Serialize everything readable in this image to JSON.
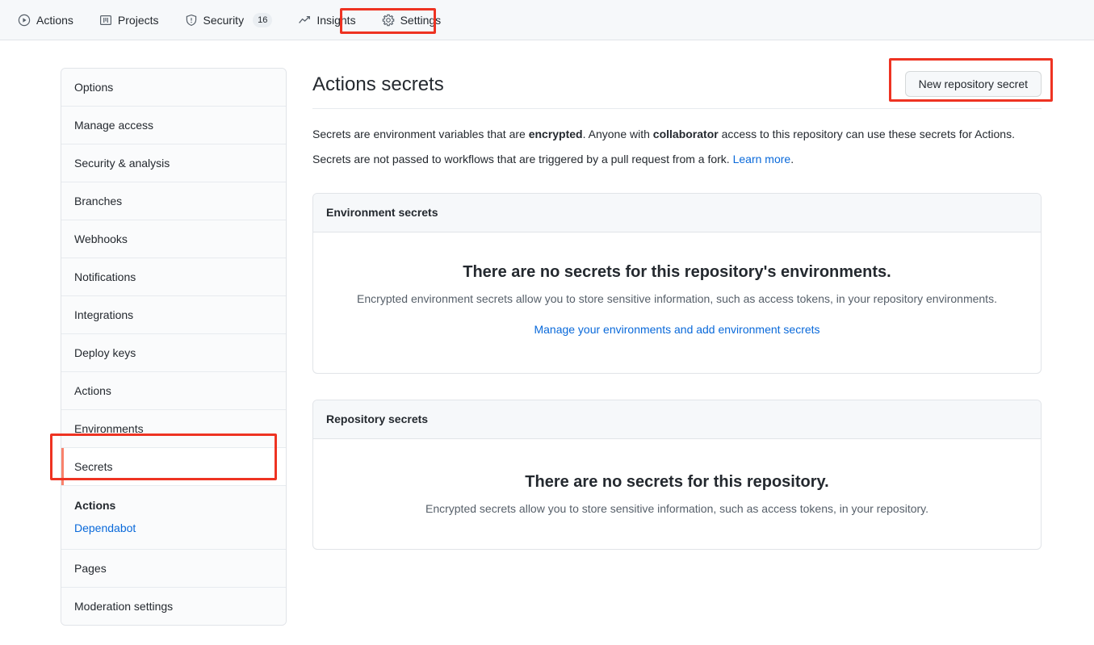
{
  "topnav": {
    "items": [
      {
        "label": "Actions",
        "icon": "play-circle-icon",
        "count": null
      },
      {
        "label": "Projects",
        "icon": "project-board-icon",
        "count": null
      },
      {
        "label": "Security",
        "icon": "shield-icon",
        "count": "16"
      },
      {
        "label": "Insights",
        "icon": "graph-icon",
        "count": null
      },
      {
        "label": "Settings",
        "icon": "gear-icon",
        "count": null
      }
    ],
    "highlighted_item": "Settings"
  },
  "sidebar": {
    "items": [
      {
        "label": "Options"
      },
      {
        "label": "Manage access"
      },
      {
        "label": "Security & analysis"
      },
      {
        "label": "Branches"
      },
      {
        "label": "Webhooks"
      },
      {
        "label": "Notifications"
      },
      {
        "label": "Integrations"
      },
      {
        "label": "Deploy keys"
      },
      {
        "label": "Actions"
      },
      {
        "label": "Environments"
      },
      {
        "label": "Secrets"
      },
      {
        "label": "Pages"
      },
      {
        "label": "Moderation settings"
      }
    ],
    "secrets_sub_items": [
      {
        "label": "Actions",
        "state": "current"
      },
      {
        "label": "Dependabot",
        "state": "link"
      }
    ],
    "selected_item": "Secrets",
    "highlighted_item": "Secrets"
  },
  "main": {
    "title": "Actions secrets",
    "new_secret_button": "New repository secret",
    "description_1": {
      "part_1": "Secrets are environment variables that are ",
      "bold_1": "encrypted",
      "part_2": ". Anyone with ",
      "bold_2": "collaborator",
      "part_3": " access to this repository can use these secrets for Actions."
    },
    "description_2": {
      "part_1": "Secrets are not passed to workflows that are triggered by a pull request from a fork. ",
      "link": "Learn more",
      "part_2": "."
    },
    "environment_secrets": {
      "header": "Environment secrets",
      "blank_title": "There are no secrets for this repository's environments.",
      "blank_text": "Encrypted environment secrets allow you to store sensitive information, such as access tokens, in your repository environments.",
      "blank_link": "Manage your environments and add environment secrets"
    },
    "repository_secrets": {
      "header": "Repository secrets",
      "blank_title": "There are no secrets for this repository.",
      "blank_text": "Encrypted secrets allow you to store sensitive information, such as access tokens, in your repository."
    }
  },
  "colors": {
    "annotation_red": "#ee3322",
    "selected_accent": "#f9826c",
    "link_blue": "#0969da",
    "header_bg": "#f6f8fa"
  }
}
